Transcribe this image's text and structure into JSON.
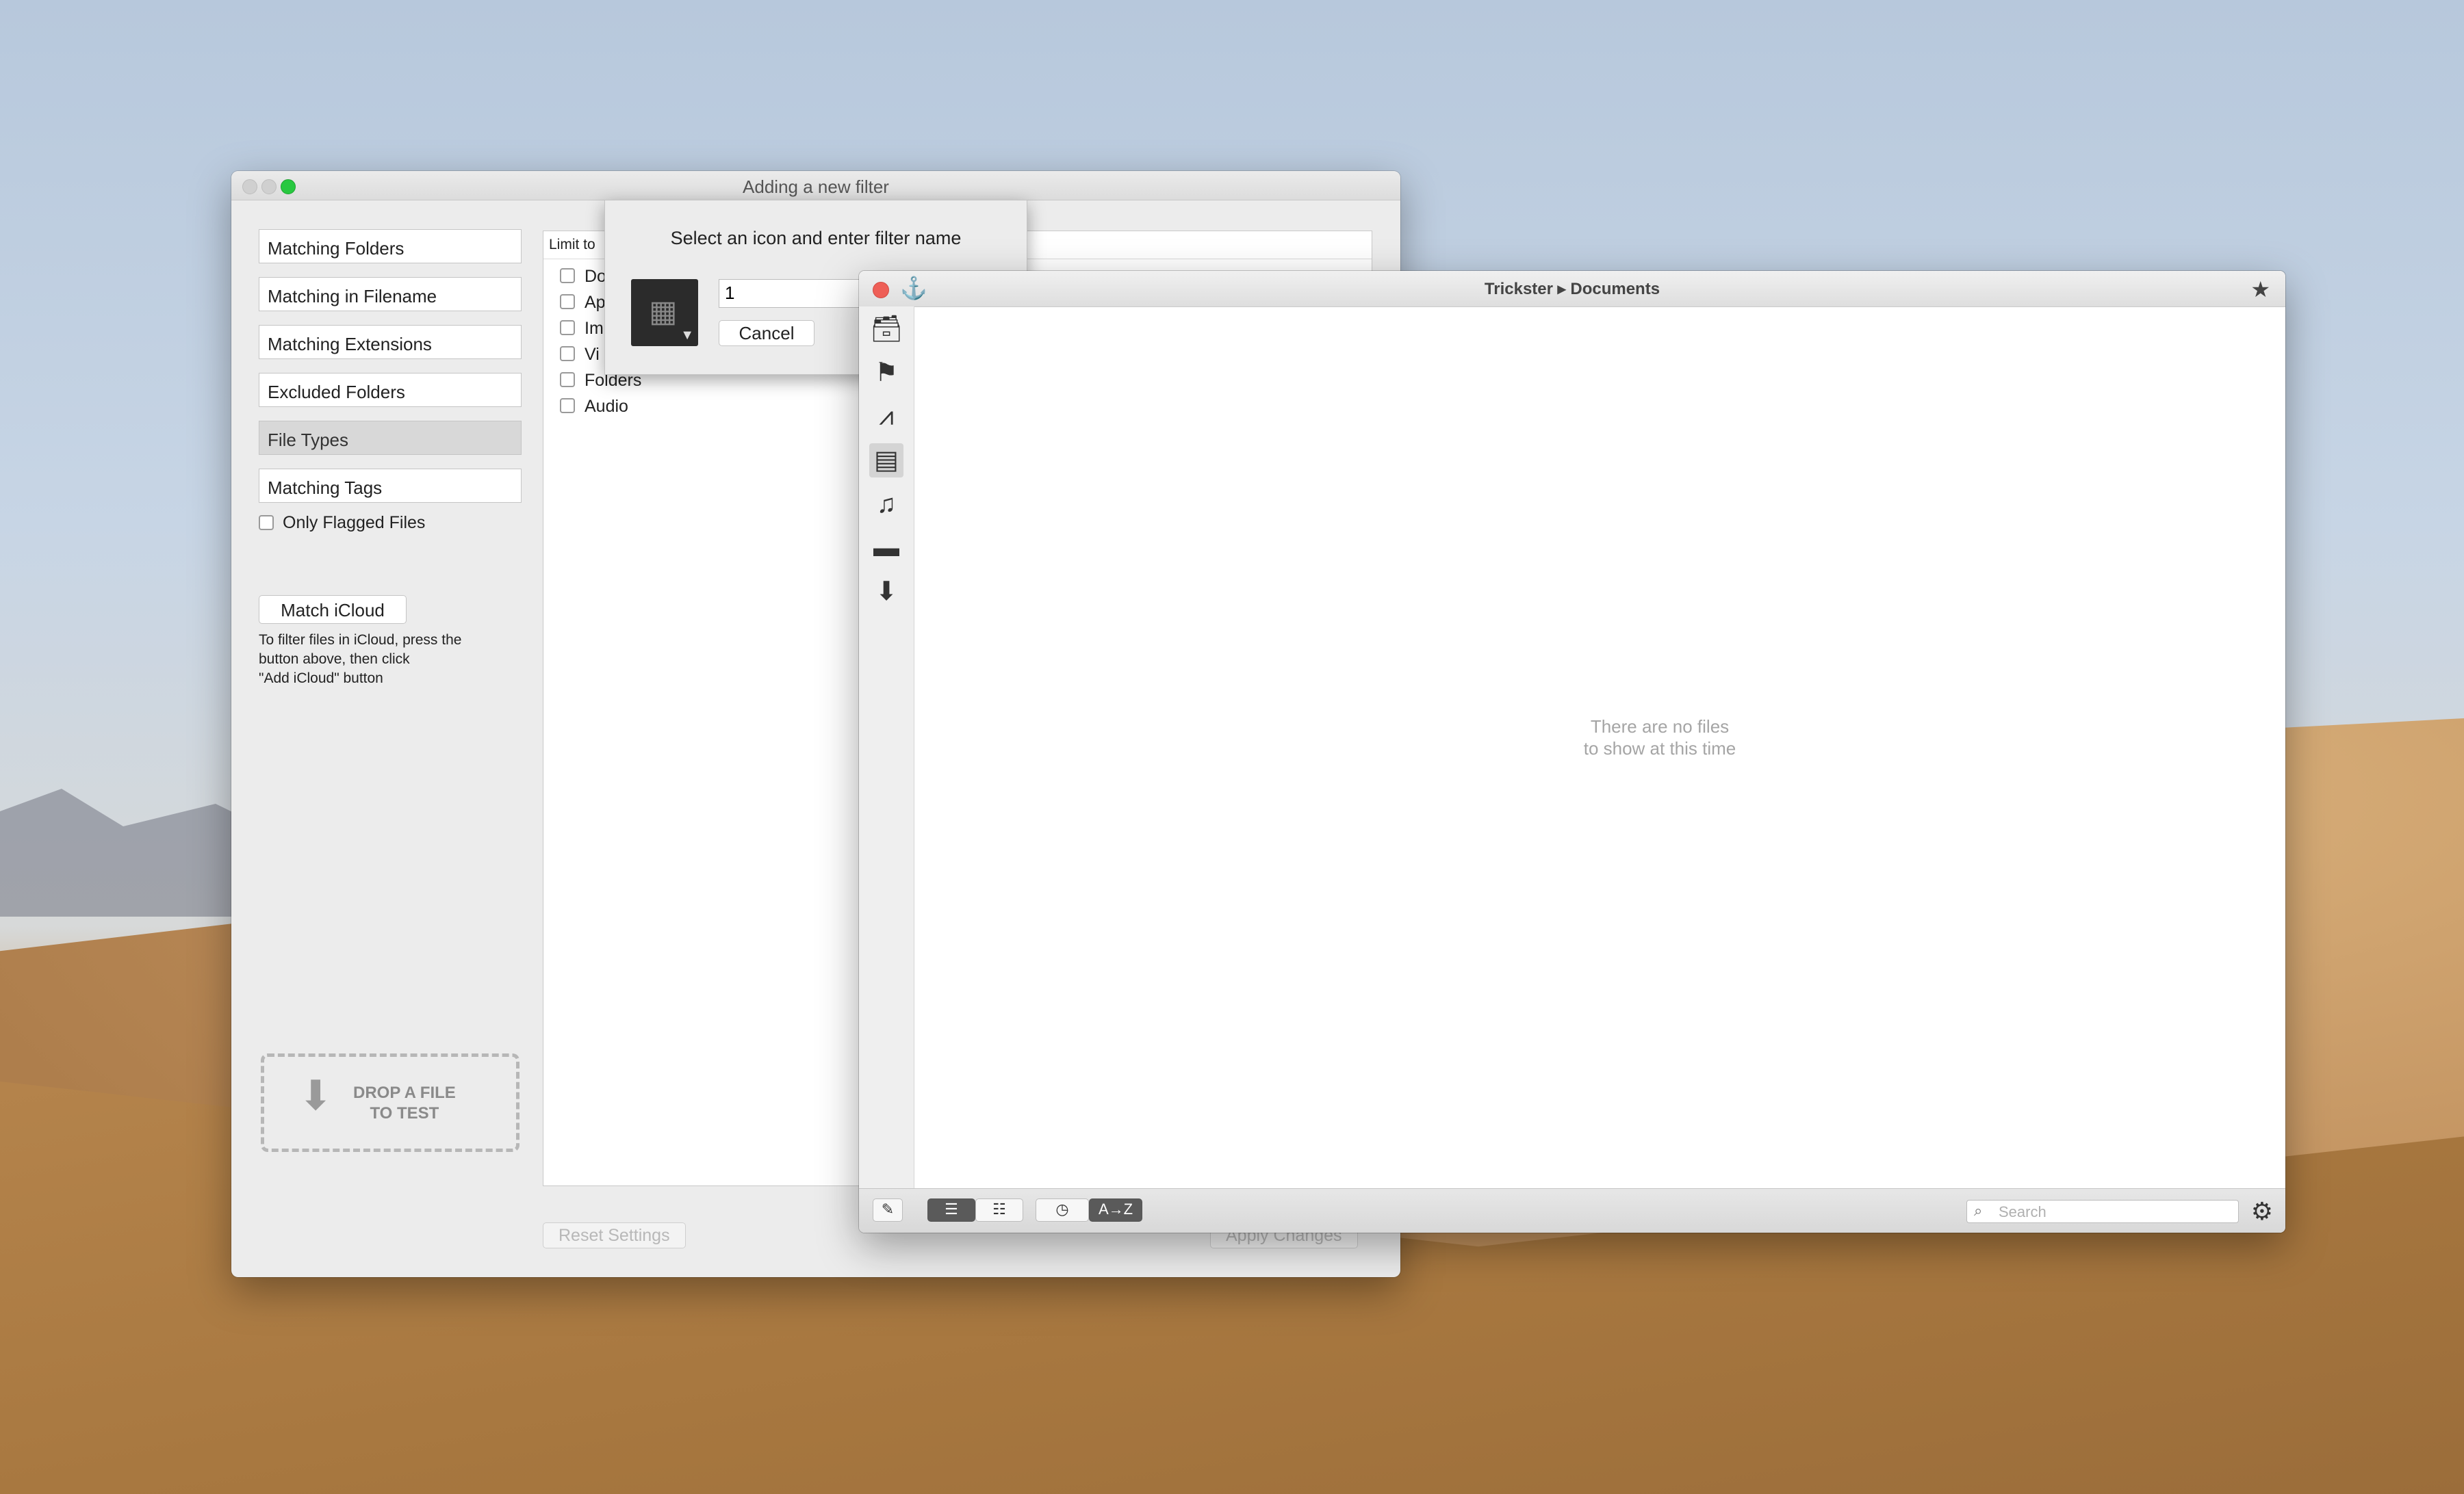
{
  "filter_window": {
    "title": "Adding a new filter",
    "filters": [
      "Matching Folders",
      "Matching in Filename",
      "Matching Extensions",
      "Excluded Folders",
      "File Types",
      "Matching Tags"
    ],
    "selected_filter": "File Types",
    "only_flagged": "Only Flagged Files",
    "match_icloud_button": "Match iCloud",
    "icloud_help": [
      "To filter files in iCloud, press the",
      "button above, then click",
      "\"Add iCloud\" button"
    ],
    "panel_label": "Limit to",
    "file_types": [
      "Do",
      "Ap",
      "Im",
      "Vi",
      "Folders",
      "Audio"
    ],
    "drop_zone": [
      "DROP A FILE",
      "TO TEST"
    ],
    "reset_button": "Reset Settings",
    "apply_button": "Apply Changes"
  },
  "sheet": {
    "title": "Select an icon and enter filter name",
    "name_value": "1",
    "cancel_button": "Cancel"
  },
  "trickster": {
    "title": "Trickster ▸ Documents",
    "sidebar_icons": [
      "inbox-icon",
      "flag-icon",
      "app-store-icon",
      "document-icon",
      "music-icon",
      "folder-icon",
      "download-icon"
    ],
    "empty_message": [
      "There are no files",
      "to show at this time"
    ],
    "footer": {
      "sort_az": "A→Z",
      "search_placeholder": "Search"
    }
  },
  "colors": {
    "close_red": "#ee5f57",
    "zoom_green": "#28c840"
  }
}
